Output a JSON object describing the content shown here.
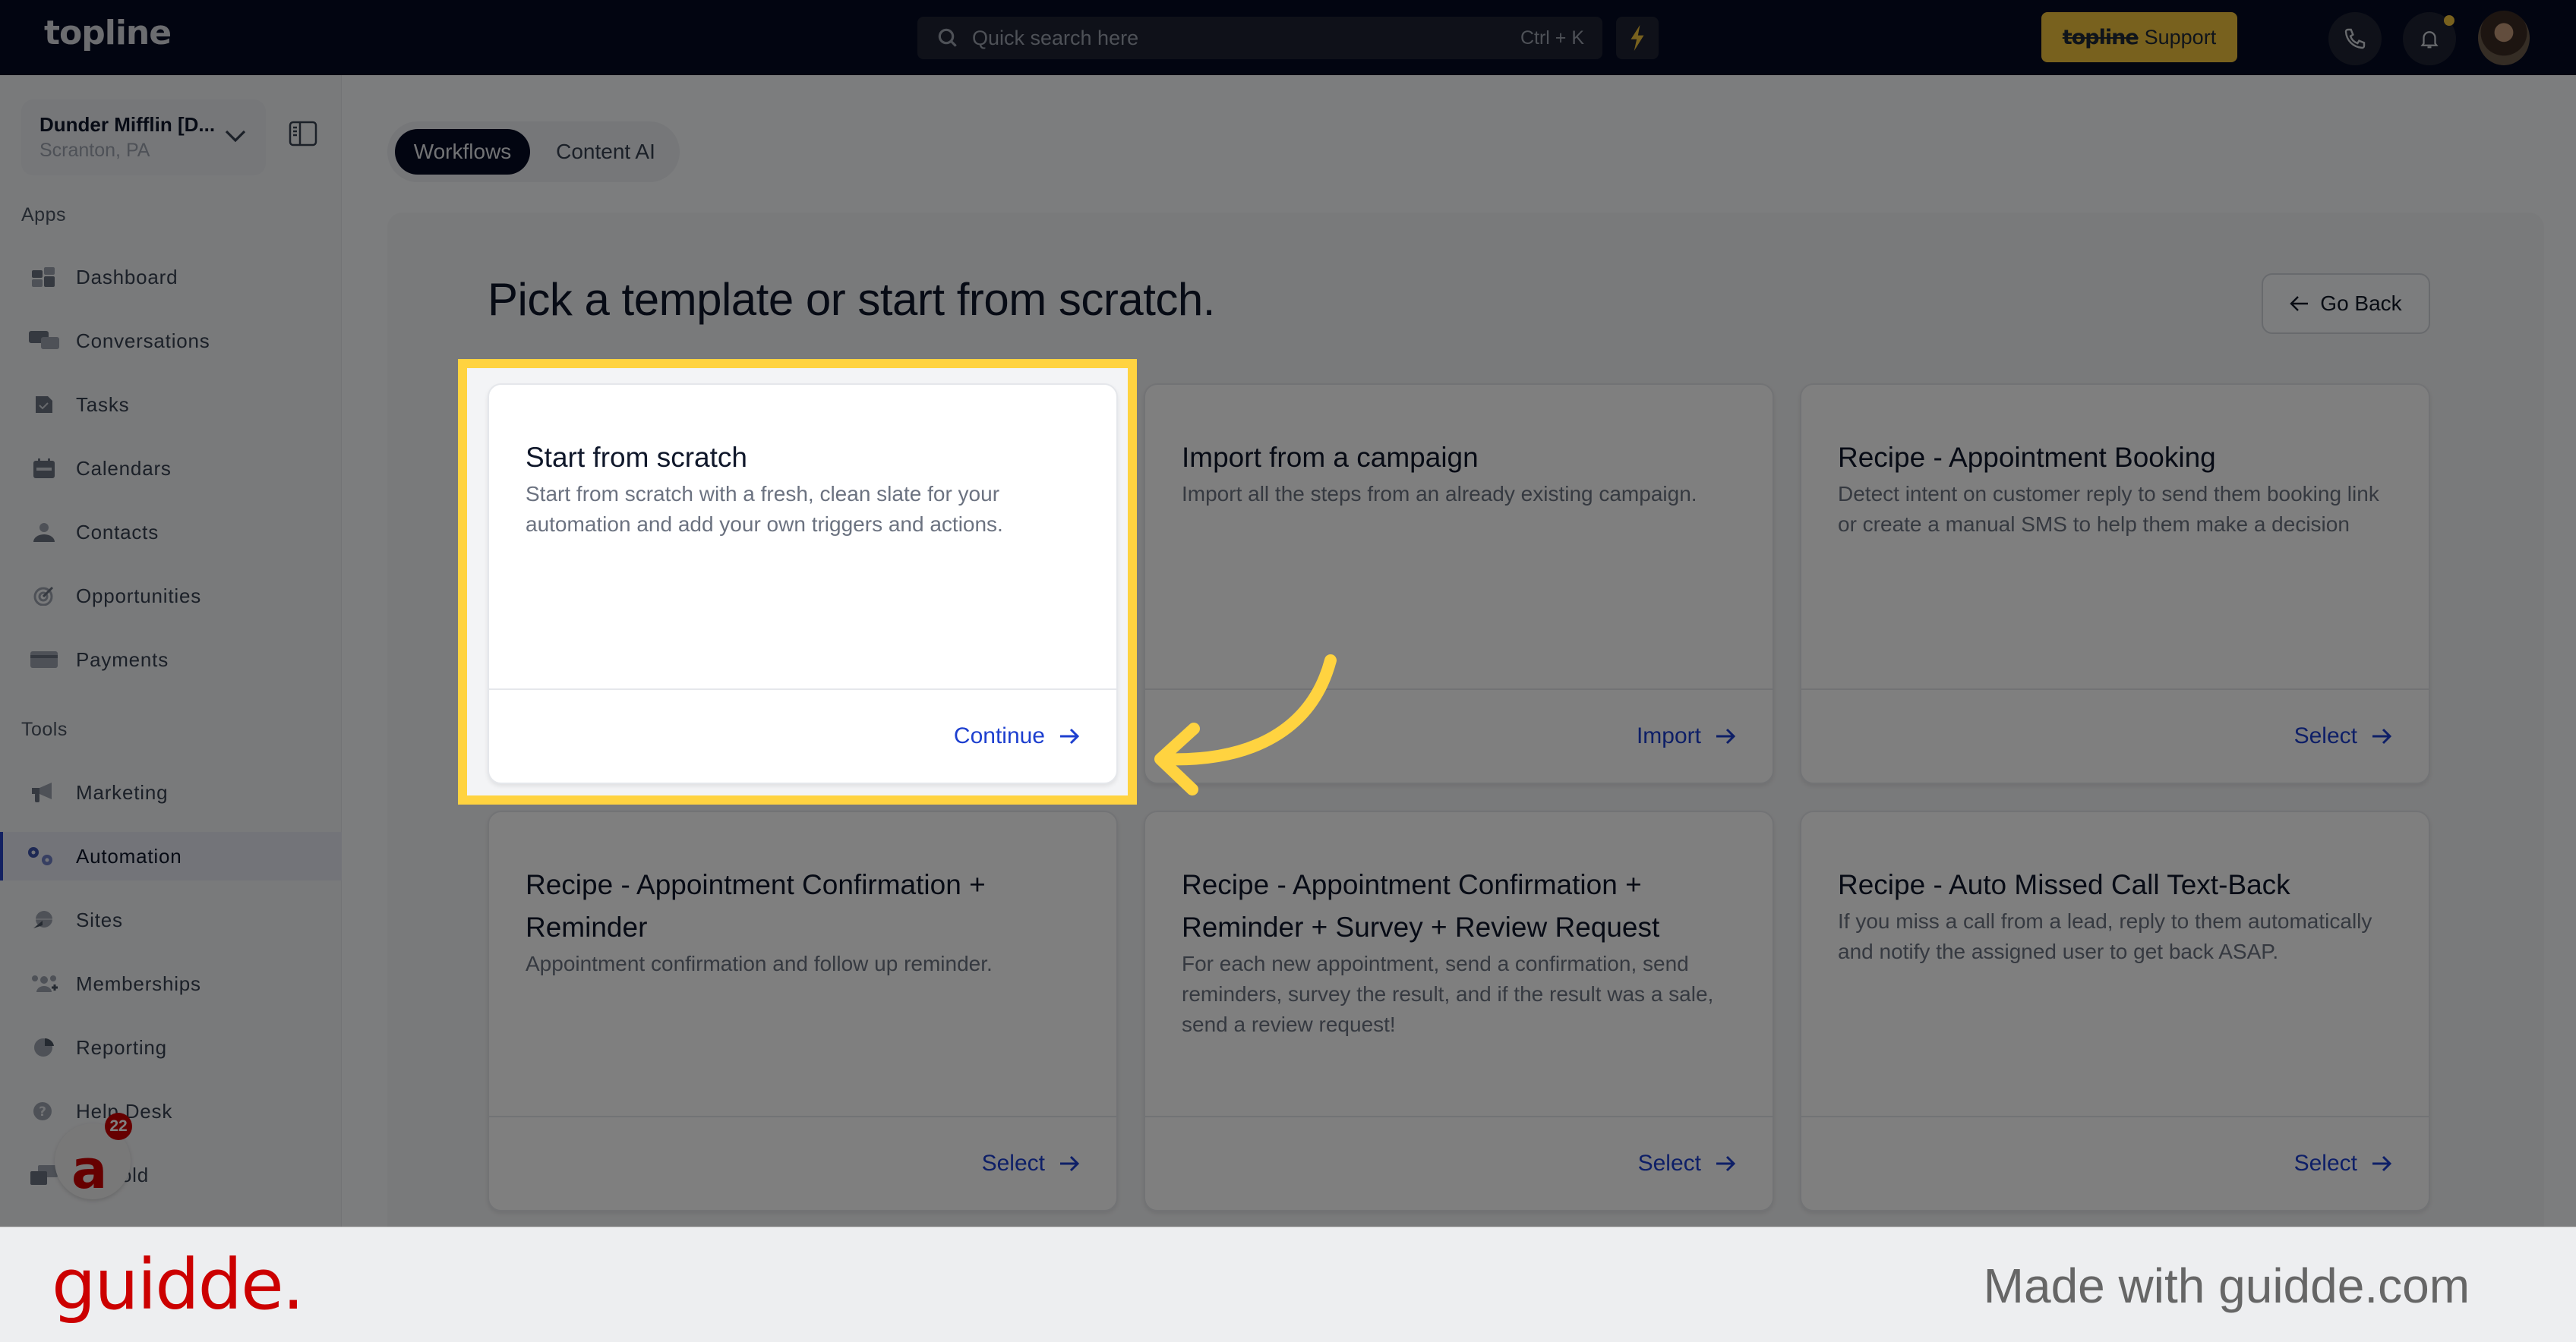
{
  "topbar": {
    "logo": "topline",
    "search_placeholder": "Quick search here",
    "search_shortcut": "Ctrl + K",
    "support_brand": "topline",
    "support_label": "Support",
    "accent_color": "#f0c23c"
  },
  "sidebar": {
    "location_name": "Dunder Mifflin [D...",
    "location_city": "Scranton, PA",
    "apps_heading": "Apps",
    "apps": [
      {
        "label": "Dashboard",
        "icon": "dashboard-icon"
      },
      {
        "label": "Conversations",
        "icon": "chat-icon"
      },
      {
        "label": "Tasks",
        "icon": "task-icon"
      },
      {
        "label": "Calendars",
        "icon": "calendar-icon"
      },
      {
        "label": "Contacts",
        "icon": "contact-icon"
      },
      {
        "label": "Opportunities",
        "icon": "target-icon"
      },
      {
        "label": "Payments",
        "icon": "credit-card-icon"
      }
    ],
    "tools_heading": "Tools",
    "tools": [
      {
        "label": "Marketing",
        "icon": "megaphone-icon"
      },
      {
        "label": "Automation",
        "icon": "gears-icon",
        "active": true
      },
      {
        "label": "Sites",
        "icon": "globe-icon"
      },
      {
        "label": "Memberships",
        "icon": "users-plus-icon"
      },
      {
        "label": "Reporting",
        "icon": "pie-chart-icon"
      },
      {
        "label": "Help Desk",
        "icon": "help-icon"
      },
      {
        "label": "Mailfold",
        "icon": "mail-icon"
      }
    ],
    "badge_count": "22"
  },
  "tabs": [
    {
      "label": "Workflows",
      "active": true
    },
    {
      "label": "Content AI",
      "active": false
    }
  ],
  "page": {
    "title": "Pick a template or start from scratch.",
    "go_back": "Go Back"
  },
  "cards": [
    {
      "title": "Start from scratch",
      "description": "Start from scratch with a fresh, clean slate for your automation and add your own triggers and actions.",
      "action": "Continue"
    },
    {
      "title": "Import from a campaign",
      "description": "Import all the steps from an already existing campaign.",
      "action": "Import"
    },
    {
      "title": "Recipe - Appointment Booking",
      "description": "Detect intent on customer reply to send them booking link or create a manual SMS to help them make a decision",
      "action": "Select"
    },
    {
      "title": "Recipe - Appointment Confirmation + Reminder",
      "description": "Appointment confirmation and follow up reminder.",
      "action": "Select"
    },
    {
      "title": "Recipe - Appointment Confirmation + Reminder + Survey + Review Request",
      "description": "For each new appointment, send a confirmation, send reminders, survey the result, and if the result was a sale, send a review request!",
      "action": "Select"
    },
    {
      "title": "Recipe - Auto Missed Call Text-Back",
      "description": "If you miss a call from a lead, reply to them automatically and notify the assigned user to get back ASAP.",
      "action": "Select"
    }
  ],
  "footer": {
    "brand": "guidde.",
    "tagline": "Made with guidde.com",
    "brand_color": "#cc0000"
  },
  "highlight_color": "#ffd340"
}
